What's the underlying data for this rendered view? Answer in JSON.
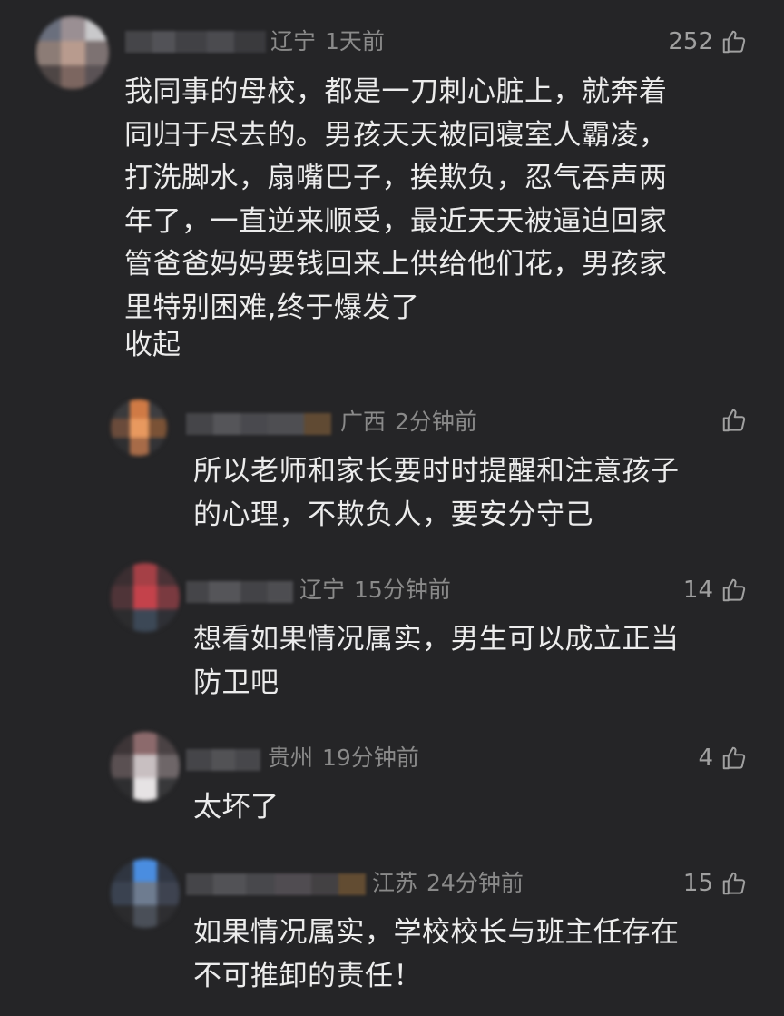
{
  "comments": [
    {
      "location": "辽宁",
      "time": "1天前",
      "likes": "252",
      "lines": [
        "我同事的母校，都是一刀刺心脏上，就奔着",
        "同归于尽去的。男孩天天被同寝室人霸凌，",
        "打洗脚水，扇嘴巴子，挨欺负，忍气吞声两",
        "年了，一直逆来顺受，最近天天被逼迫回家",
        "管爸爸妈妈要钱回来上供给他们花，男孩家",
        "里特别困难,终于爆发了"
      ],
      "collapse_label": "收起"
    },
    {
      "location": "广西",
      "time": "2分钟前",
      "likes": "",
      "lines": [
        "所以老师和家长要时时提醒和注意孩子",
        "的心理，不欺负人，要安分守己"
      ]
    },
    {
      "location": "辽宁",
      "time": "15分钟前",
      "likes": "14",
      "lines": [
        "想看如果情况属实，男生可以成立正当",
        "防卫吧"
      ]
    },
    {
      "location": "贵州",
      "time": "19分钟前",
      "likes": "4",
      "lines": [
        "太坏了"
      ]
    },
    {
      "location": "江苏",
      "time": "24分钟前",
      "likes": "15",
      "lines": [
        "如果情况属实，学校校长与班主任存在",
        "不可推卸的责任！"
      ]
    }
  ],
  "icons": {
    "like": "thumbs-up-icon"
  },
  "colors": {
    "background": "#252527",
    "meta_text": "#8a8a8a",
    "body_text": "#ececec"
  }
}
